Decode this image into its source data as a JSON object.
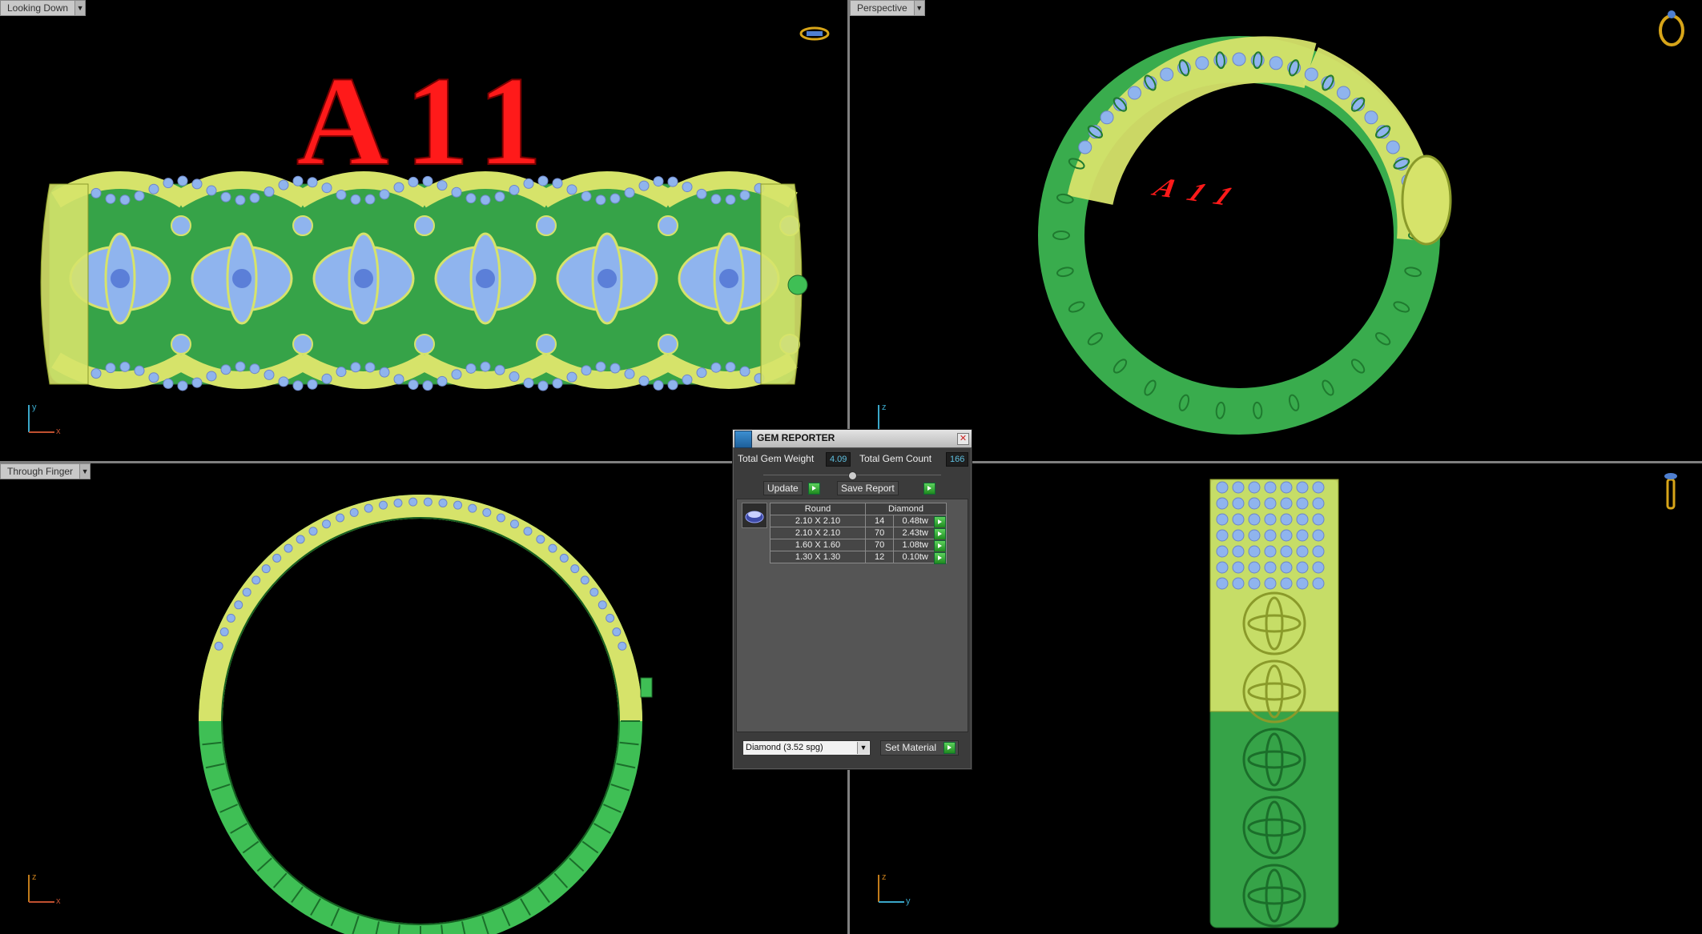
{
  "viewports": {
    "top_left": {
      "label": "Looking Down",
      "axis_v": "y",
      "axis_h": "x"
    },
    "top_right": {
      "label": "Perspective",
      "axis_v": "z"
    },
    "bottom_left": {
      "label": "Through Finger",
      "axis_v": "z",
      "axis_h": "x"
    },
    "bottom_right": {
      "label": "",
      "axis_v": "z",
      "axis_h": "y"
    }
  },
  "model_text": "A11",
  "icons": {
    "top_left": "ring-top-view-icon",
    "top_right": "ring-perspective-icon",
    "bottom_right": "ring-side-view-icon"
  },
  "gem_reporter": {
    "title": "GEM REPORTER",
    "total_weight_label": "Total Gem Weight",
    "total_weight": "4.09",
    "total_count_label": "Total Gem Count",
    "total_count": "166",
    "update_label": "Update",
    "save_report_label": "Save Report",
    "columns": [
      "Round",
      "Diamond"
    ],
    "rows": [
      {
        "size": "2.10 X 2.10",
        "count": "14",
        "weight": "0.48tw"
      },
      {
        "size": "2.10 X 2.10",
        "count": "70",
        "weight": "2.43tw"
      },
      {
        "size": "1.60 X 1.60",
        "count": "70",
        "weight": "1.08tw"
      },
      {
        "size": "1.30 X 1.30",
        "count": "12",
        "weight": "0.10tw"
      }
    ],
    "material_select": "Diamond     (3.52 spg)",
    "set_material_label": "Set Material"
  },
  "colors": {
    "gold": "#d6e36a",
    "green": "#3fbf55",
    "gem": "#8fb4ee",
    "text_red": "#ff1a1a",
    "background": "#000000"
  }
}
